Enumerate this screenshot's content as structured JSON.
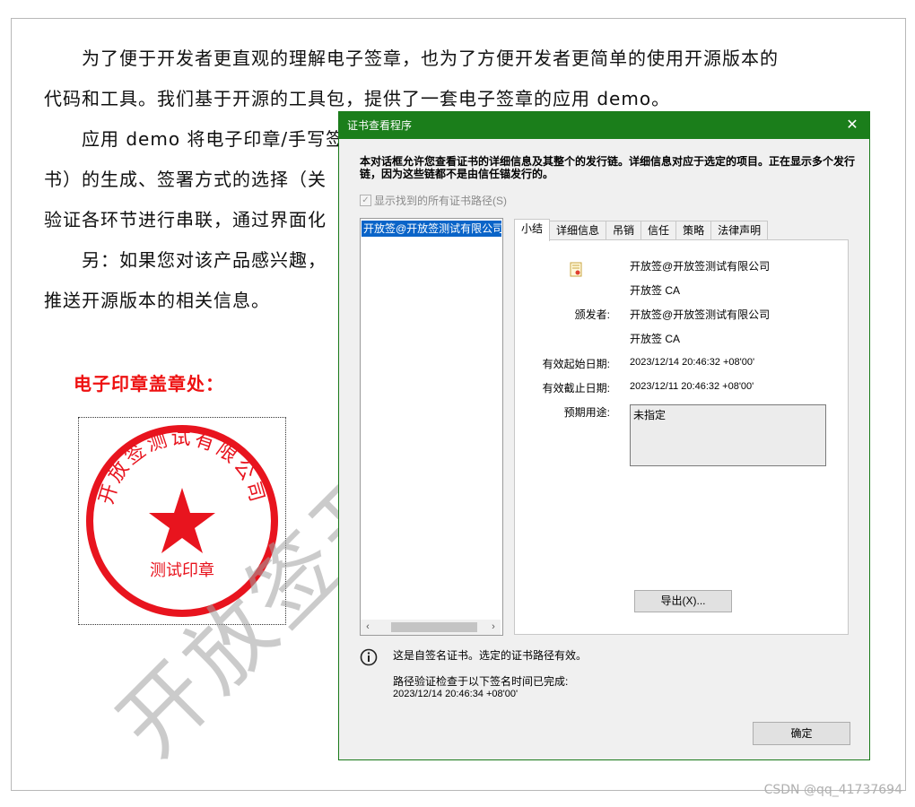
{
  "document": {
    "paragraphs": [
      "　　为了便于开发者更直观的理解电子签章，也为了方便开发者更简单的使用开源版本的",
      "代码和工具。我们基于开源的工具包，提供了一套电子签章的应用 demo。",
      "　　应用 demo 将电子印章/手写签",
      "书）的生成、签署方式的选择（关",
      "验证各环节进行串联，通过界面化",
      "　　另：如果您对该产品感兴趣，",
      "推送开源版本的相关信息。"
    ],
    "seal_heading": "电子印章盖章处：",
    "seal": {
      "arc_text": "开放签测试有限公司",
      "center_text": "测试印章",
      "color": "#e8141e"
    },
    "watermark": "开放签开源版",
    "credit": "CSDN @qq_41737694"
  },
  "dialog": {
    "title": "证书查看程序",
    "close_icon": "close-icon",
    "description": "本对话框允许您查看证书的详细信息及其整个的发行链。详细信息对应于选定的项目。正在显示多个发行链，因为这些链都不是由信任锚发行的。",
    "show_all_paths_label": "显示找到的所有证书路径(S)",
    "tree_item": "开放签@开放签测试有限公司",
    "tabs": [
      "小结",
      "详细信息",
      "吊销",
      "信任",
      "策略",
      "法律声明"
    ],
    "summary": {
      "subject_name": "开放签@开放签测试有限公司",
      "subject_org": "开放签 CA",
      "issuer_label": "颁发者:",
      "issuer_name": "开放签@开放签测试有限公司",
      "issuer_org": "开放签 CA",
      "valid_from_label": "有效起始日期:",
      "valid_from": "2023/12/14 20:46:32 +08'00'",
      "valid_to_label": "有效截止日期:",
      "valid_to": "2023/12/11 20:46:32 +08'00'",
      "purpose_label": "预期用途:",
      "purpose_value": "未指定",
      "export_label": "导出(X)..."
    },
    "info_line1": "这是自签名证书。选定的证书路径有效。",
    "info_line2": "路径验证检查于以下签名时间已完成:",
    "info_line3": "2023/12/14 20:46:34 +08'00'",
    "ok_label": "确定",
    "accent_color": "#1b7e1b"
  }
}
